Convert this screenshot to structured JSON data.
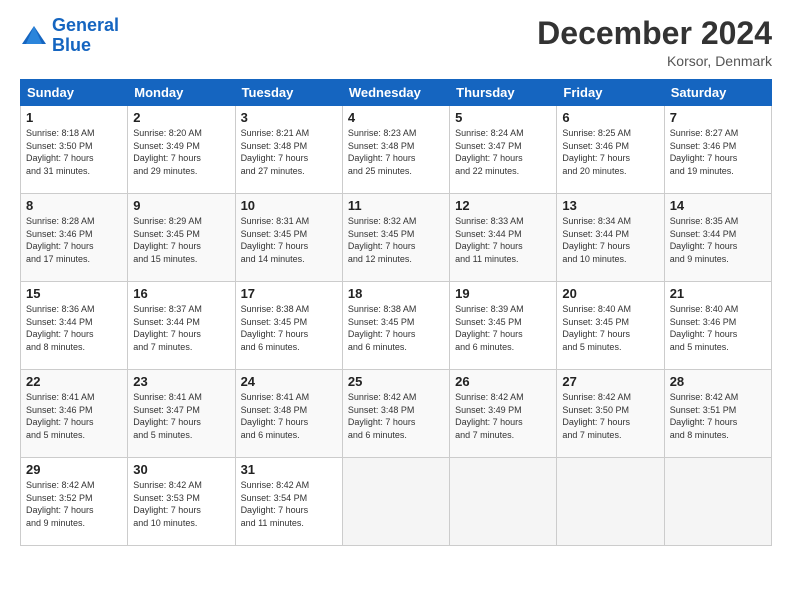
{
  "logo": {
    "line1": "General",
    "line2": "Blue"
  },
  "header": {
    "month": "December 2024",
    "location": "Korsor, Denmark"
  },
  "weekdays": [
    "Sunday",
    "Monday",
    "Tuesday",
    "Wednesday",
    "Thursday",
    "Friday",
    "Saturday"
  ],
  "weeks": [
    [
      {
        "day": "1",
        "info": "Sunrise: 8:18 AM\nSunset: 3:50 PM\nDaylight: 7 hours\nand 31 minutes."
      },
      {
        "day": "2",
        "info": "Sunrise: 8:20 AM\nSunset: 3:49 PM\nDaylight: 7 hours\nand 29 minutes."
      },
      {
        "day": "3",
        "info": "Sunrise: 8:21 AM\nSunset: 3:48 PM\nDaylight: 7 hours\nand 27 minutes."
      },
      {
        "day": "4",
        "info": "Sunrise: 8:23 AM\nSunset: 3:48 PM\nDaylight: 7 hours\nand 25 minutes."
      },
      {
        "day": "5",
        "info": "Sunrise: 8:24 AM\nSunset: 3:47 PM\nDaylight: 7 hours\nand 22 minutes."
      },
      {
        "day": "6",
        "info": "Sunrise: 8:25 AM\nSunset: 3:46 PM\nDaylight: 7 hours\nand 20 minutes."
      },
      {
        "day": "7",
        "info": "Sunrise: 8:27 AM\nSunset: 3:46 PM\nDaylight: 7 hours\nand 19 minutes."
      }
    ],
    [
      {
        "day": "8",
        "info": "Sunrise: 8:28 AM\nSunset: 3:46 PM\nDaylight: 7 hours\nand 17 minutes."
      },
      {
        "day": "9",
        "info": "Sunrise: 8:29 AM\nSunset: 3:45 PM\nDaylight: 7 hours\nand 15 minutes."
      },
      {
        "day": "10",
        "info": "Sunrise: 8:31 AM\nSunset: 3:45 PM\nDaylight: 7 hours\nand 14 minutes."
      },
      {
        "day": "11",
        "info": "Sunrise: 8:32 AM\nSunset: 3:45 PM\nDaylight: 7 hours\nand 12 minutes."
      },
      {
        "day": "12",
        "info": "Sunrise: 8:33 AM\nSunset: 3:44 PM\nDaylight: 7 hours\nand 11 minutes."
      },
      {
        "day": "13",
        "info": "Sunrise: 8:34 AM\nSunset: 3:44 PM\nDaylight: 7 hours\nand 10 minutes."
      },
      {
        "day": "14",
        "info": "Sunrise: 8:35 AM\nSunset: 3:44 PM\nDaylight: 7 hours\nand 9 minutes."
      }
    ],
    [
      {
        "day": "15",
        "info": "Sunrise: 8:36 AM\nSunset: 3:44 PM\nDaylight: 7 hours\nand 8 minutes."
      },
      {
        "day": "16",
        "info": "Sunrise: 8:37 AM\nSunset: 3:44 PM\nDaylight: 7 hours\nand 7 minutes."
      },
      {
        "day": "17",
        "info": "Sunrise: 8:38 AM\nSunset: 3:45 PM\nDaylight: 7 hours\nand 6 minutes."
      },
      {
        "day": "18",
        "info": "Sunrise: 8:38 AM\nSunset: 3:45 PM\nDaylight: 7 hours\nand 6 minutes."
      },
      {
        "day": "19",
        "info": "Sunrise: 8:39 AM\nSunset: 3:45 PM\nDaylight: 7 hours\nand 6 minutes."
      },
      {
        "day": "20",
        "info": "Sunrise: 8:40 AM\nSunset: 3:45 PM\nDaylight: 7 hours\nand 5 minutes."
      },
      {
        "day": "21",
        "info": "Sunrise: 8:40 AM\nSunset: 3:46 PM\nDaylight: 7 hours\nand 5 minutes."
      }
    ],
    [
      {
        "day": "22",
        "info": "Sunrise: 8:41 AM\nSunset: 3:46 PM\nDaylight: 7 hours\nand 5 minutes."
      },
      {
        "day": "23",
        "info": "Sunrise: 8:41 AM\nSunset: 3:47 PM\nDaylight: 7 hours\nand 5 minutes."
      },
      {
        "day": "24",
        "info": "Sunrise: 8:41 AM\nSunset: 3:48 PM\nDaylight: 7 hours\nand 6 minutes."
      },
      {
        "day": "25",
        "info": "Sunrise: 8:42 AM\nSunset: 3:48 PM\nDaylight: 7 hours\nand 6 minutes."
      },
      {
        "day": "26",
        "info": "Sunrise: 8:42 AM\nSunset: 3:49 PM\nDaylight: 7 hours\nand 7 minutes."
      },
      {
        "day": "27",
        "info": "Sunrise: 8:42 AM\nSunset: 3:50 PM\nDaylight: 7 hours\nand 7 minutes."
      },
      {
        "day": "28",
        "info": "Sunrise: 8:42 AM\nSunset: 3:51 PM\nDaylight: 7 hours\nand 8 minutes."
      }
    ],
    [
      {
        "day": "29",
        "info": "Sunrise: 8:42 AM\nSunset: 3:52 PM\nDaylight: 7 hours\nand 9 minutes."
      },
      {
        "day": "30",
        "info": "Sunrise: 8:42 AM\nSunset: 3:53 PM\nDaylight: 7 hours\nand 10 minutes."
      },
      {
        "day": "31",
        "info": "Sunrise: 8:42 AM\nSunset: 3:54 PM\nDaylight: 7 hours\nand 11 minutes."
      },
      null,
      null,
      null,
      null
    ]
  ]
}
